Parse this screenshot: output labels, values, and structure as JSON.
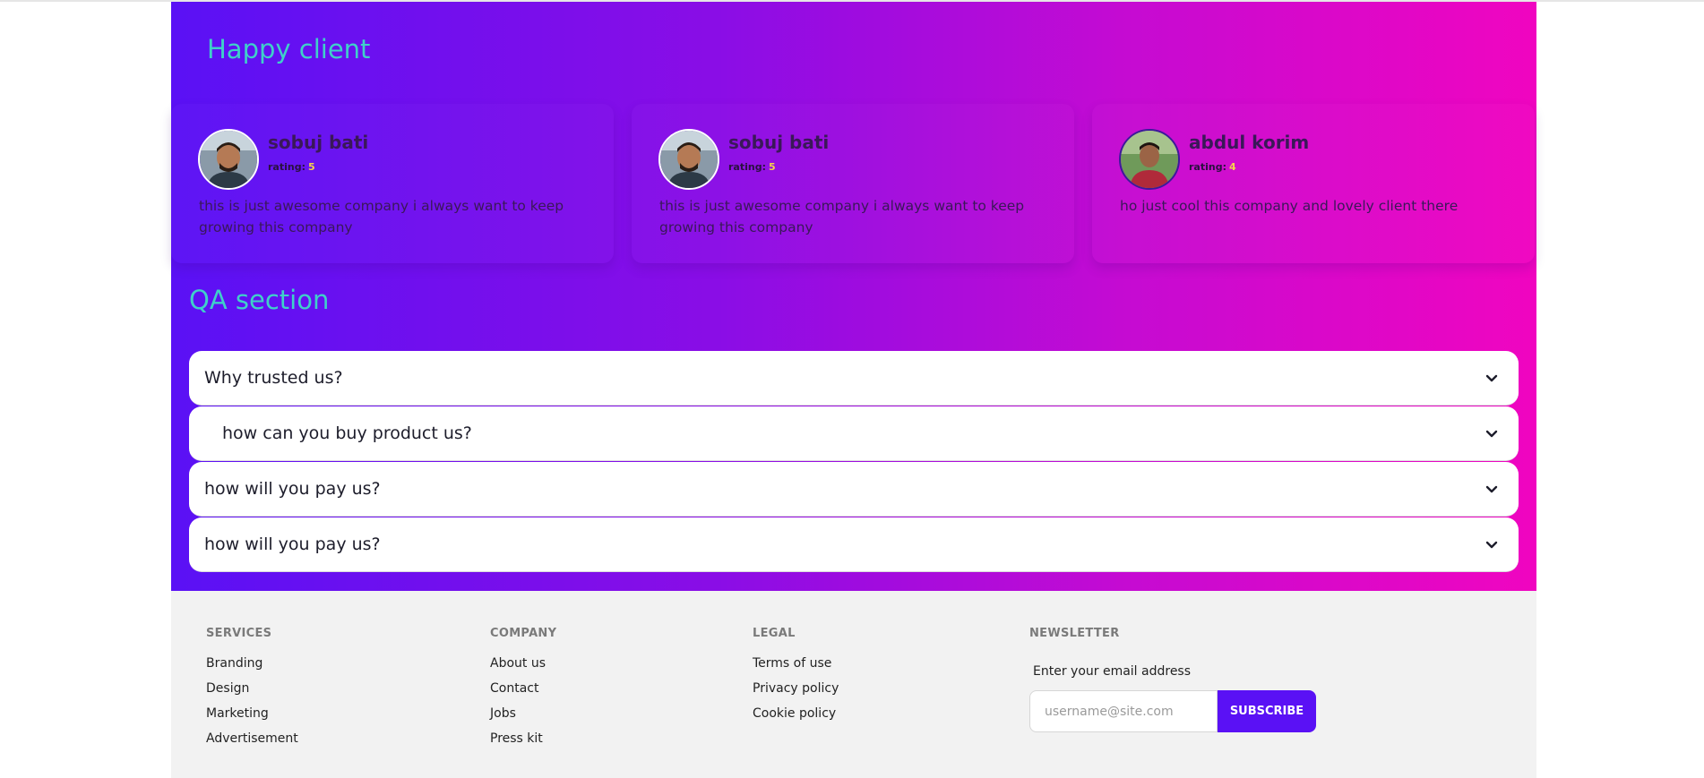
{
  "testimonials": {
    "title": "Happy client",
    "items": [
      {
        "name": "sobuj bati",
        "rating_label": "rating:",
        "rating": "5",
        "review": "this is just awesome company i always want to keep growing this company",
        "avatar": "person-photo"
      },
      {
        "name": "sobuj bati",
        "rating_label": "rating:",
        "rating": "5",
        "review": "this is just awesome company i always want to keep growing this company",
        "avatar": "person-photo"
      },
      {
        "name": "abdul korim",
        "rating_label": "rating:",
        "rating": "4",
        "review": "ho just cool this company and lovely client there",
        "avatar": "person-photo"
      }
    ]
  },
  "qa": {
    "title": "QA section",
    "items": [
      {
        "question": "Why trusted us?"
      },
      {
        "question": "how can you buy product us?"
      },
      {
        "question": "how will you pay us?"
      },
      {
        "question": "how will you pay us?"
      }
    ]
  },
  "footer": {
    "services": {
      "title": "SERVICES",
      "links": [
        "Branding",
        "Design",
        "Marketing",
        "Advertisement"
      ]
    },
    "company": {
      "title": "COMPANY",
      "links": [
        "About us",
        "Contact",
        "Jobs",
        "Press kit"
      ]
    },
    "legal": {
      "title": "LEGAL",
      "links": [
        "Terms of use",
        "Privacy policy",
        "Cookie policy"
      ]
    },
    "newsletter": {
      "title": "NEWSLETTER",
      "label": "Enter your email address",
      "placeholder": "username@site.com",
      "button": "SUBSCRIBE"
    }
  },
  "colors": {
    "gradient_start": "#5a11f5",
    "gradient_end": "#f005c0",
    "heading": "#3fd0c9",
    "rating_score": "#f5d34a",
    "subscribe_button": "#5a11f5"
  }
}
